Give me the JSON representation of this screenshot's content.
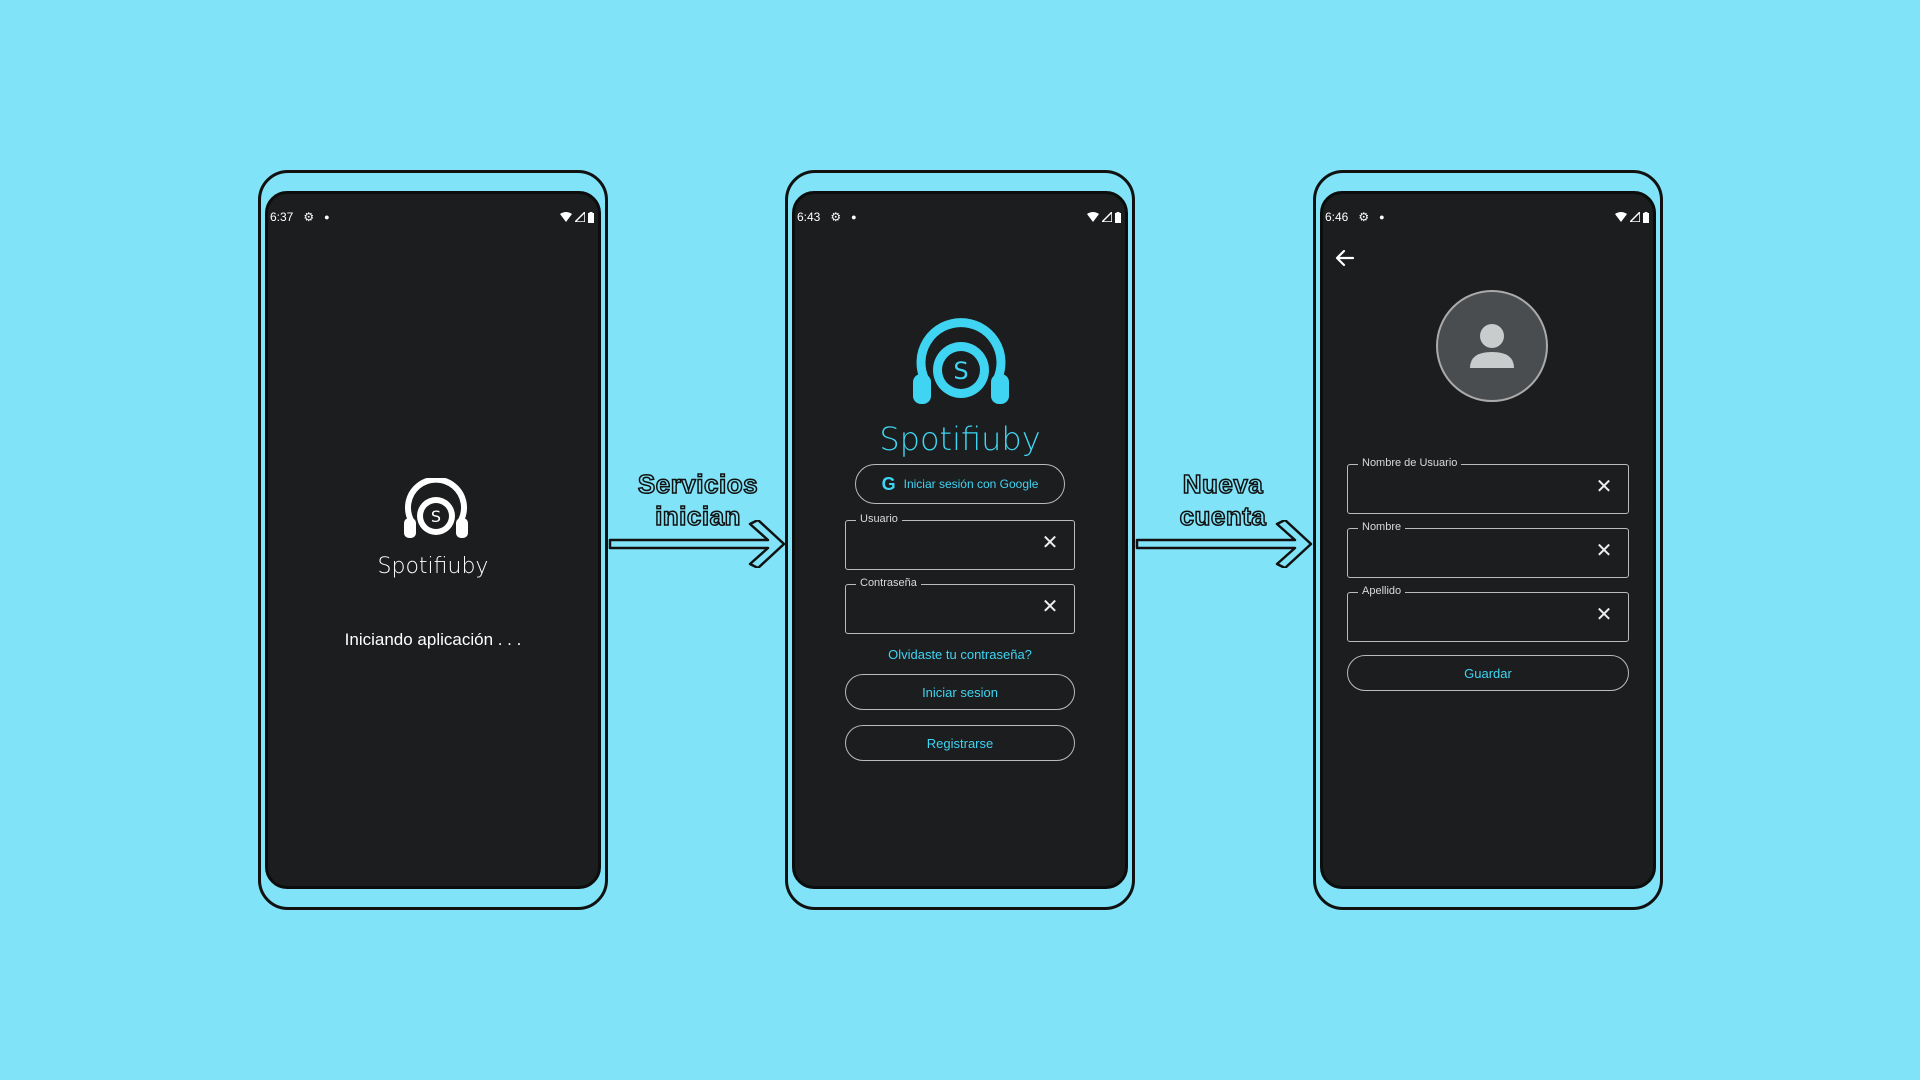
{
  "colors": {
    "background": "#80e3f7",
    "screen": "#1b1d1e",
    "accent": "#3fd4f2"
  },
  "phone1": {
    "time": "6:37",
    "app_name": "Spotifiuby",
    "logo_letter": "S",
    "loading_text": "Iniciando aplicación . . ."
  },
  "arrow1": {
    "line1": "Servicios",
    "line2": "inician"
  },
  "phone2": {
    "time": "6:43",
    "logo_letter": "S",
    "app_name": "Spotifiuby",
    "google_button": "Iniciar sesión con Google",
    "username_label": "Usuario",
    "password_label": "Contraseña",
    "forgot_link": "Olvidaste tu contraseña?",
    "login_button": "Iniciar sesion",
    "register_button": "Registrarse"
  },
  "arrow2": {
    "line1": "Nueva",
    "line2": "cuenta"
  },
  "phone3": {
    "time": "6:46",
    "username_label": "Nombre de Usuario",
    "name_label": "Nombre",
    "lastname_label": "Apellido",
    "save_button": "Guardar"
  }
}
